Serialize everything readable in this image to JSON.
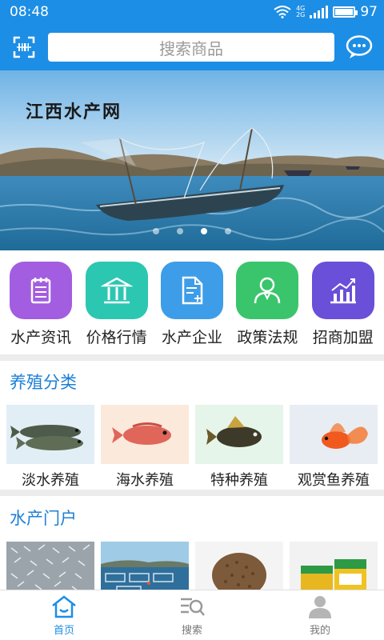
{
  "status_bar": {
    "time": "08:48",
    "network_top": "4G",
    "network_bottom": "2G",
    "battery": "97"
  },
  "app_bar": {
    "search_placeholder": "搜索商品"
  },
  "banner": {
    "caption": "江西水产网",
    "slide_count": 4,
    "active_slide": 3
  },
  "categories": [
    {
      "label": "水产资讯",
      "color": "#a35de0",
      "icon": "notepad-icon"
    },
    {
      "label": "价格行情",
      "color": "#2cc7b1",
      "icon": "bank-icon"
    },
    {
      "label": "水产企业",
      "color": "#3d9de8",
      "icon": "document-add-icon"
    },
    {
      "label": "政策法规",
      "color": "#3ac56c",
      "icon": "person-icon"
    },
    {
      "label": "招商加盟",
      "color": "#6a4fd8",
      "icon": "bar-chart-icon"
    }
  ],
  "breeding": {
    "title": "养殖分类",
    "items": [
      {
        "label": "淡水养殖"
      },
      {
        "label": "海水养殖"
      },
      {
        "label": "特种养殖"
      },
      {
        "label": "观赏鱼养殖"
      }
    ]
  },
  "portal": {
    "title": "水产门户"
  },
  "bottom_nav": [
    {
      "label": "首页",
      "icon": "home-icon",
      "active": true
    },
    {
      "label": "搜索",
      "icon": "list-search-icon",
      "active": false
    },
    {
      "label": "我的",
      "icon": "user-icon",
      "active": false
    }
  ],
  "colors": {
    "primary": "#1d8ee5",
    "section_title": "#1d7fd6"
  }
}
